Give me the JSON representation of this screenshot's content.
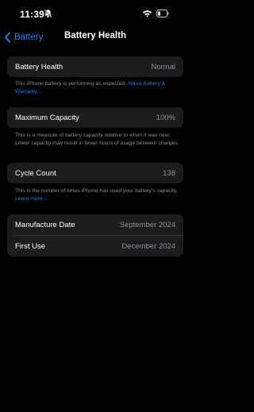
{
  "status_bar": {
    "time": "11:39"
  },
  "nav": {
    "back_label": "Battery",
    "title": "Battery Health"
  },
  "battery_health": {
    "label": "Battery Health",
    "value": "Normal"
  },
  "battery_health_note": {
    "text": "This iPhone battery is performing as expected. ",
    "link": "About Battery & Warranty..."
  },
  "maximum_capacity": {
    "label": "Maximum Capacity",
    "value": "100%"
  },
  "maximum_capacity_note": {
    "text": "This is a measure of battery capacity relative to when it was new. Lower capacity may result in fewer hours of usage between charges."
  },
  "cycle_count": {
    "label": "Cycle Count",
    "value": "138"
  },
  "cycle_count_note": {
    "text": "This is the number of times iPhone has used your battery's capacity. ",
    "link": "Learn more..."
  },
  "dates": {
    "manufacture_label": "Manufacture Date",
    "manufacture_value": "September 2024",
    "first_use_label": "First Use",
    "first_use_value": "December 2024"
  },
  "colors": {
    "accent": "#0a84ff",
    "group_bg": "#1c1c1e",
    "secondary_text": "#8e8e93"
  },
  "icons": [
    "focus-icon",
    "wifi-icon",
    "battery-icon",
    "chevron-left-icon"
  ]
}
